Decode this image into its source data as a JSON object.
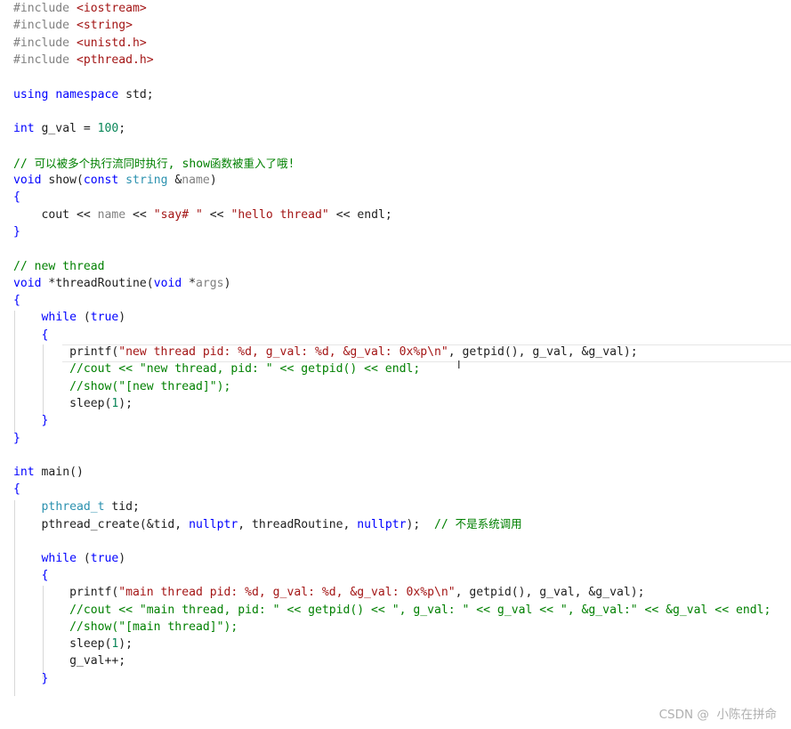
{
  "editor": {
    "lines": [
      [
        {
          "t": "#include ",
          "k": "pp"
        },
        {
          "t": "<iostream>",
          "k": "inc"
        }
      ],
      [
        {
          "t": "#include ",
          "k": "pp"
        },
        {
          "t": "<string>",
          "k": "inc"
        }
      ],
      [
        {
          "t": "#include ",
          "k": "pp"
        },
        {
          "t": "<unistd.h>",
          "k": "inc"
        }
      ],
      [
        {
          "t": "#include ",
          "k": "pp"
        },
        {
          "t": "<pthread.h>",
          "k": "inc"
        }
      ],
      [],
      [
        {
          "t": "using",
          "k": "kw"
        },
        {
          "t": " ",
          "k": "pl"
        },
        {
          "t": "namespace",
          "k": "kw"
        },
        {
          "t": " std;",
          "k": "pl"
        }
      ],
      [],
      [
        {
          "t": "int",
          "k": "kw"
        },
        {
          "t": " g_val = ",
          "k": "pl"
        },
        {
          "t": "100",
          "k": "num"
        },
        {
          "t": ";",
          "k": "pl"
        }
      ],
      [],
      [
        {
          "t": "// 可以被多个执行流同时执行, show函数被重入了哦!",
          "k": "cm"
        }
      ],
      [
        {
          "t": "void",
          "k": "kw"
        },
        {
          "t": " show",
          "k": "fn"
        },
        {
          "t": "(",
          "k": "pl"
        },
        {
          "t": "const",
          "k": "kw"
        },
        {
          "t": " ",
          "k": "pl"
        },
        {
          "t": "string",
          "k": "typ"
        },
        {
          "t": " &",
          "k": "pl"
        },
        {
          "t": "name",
          "k": "par"
        },
        {
          "t": ")",
          "k": "pl"
        }
      ],
      [
        {
          "t": "{",
          "k": "br"
        }
      ],
      [
        {
          "t": "    cout << ",
          "k": "pl"
        },
        {
          "t": "name",
          "k": "par"
        },
        {
          "t": " << ",
          "k": "pl"
        },
        {
          "t": "\"say# \"",
          "k": "str"
        },
        {
          "t": " << ",
          "k": "pl"
        },
        {
          "t": "\"hello thread\"",
          "k": "str"
        },
        {
          "t": " << endl;",
          "k": "pl"
        }
      ],
      [
        {
          "t": "}",
          "k": "br"
        }
      ],
      [],
      [
        {
          "t": "// new thread",
          "k": "cm"
        }
      ],
      [
        {
          "t": "void",
          "k": "kw"
        },
        {
          "t": " *threadRoutine(",
          "k": "pl"
        },
        {
          "t": "void",
          "k": "kw"
        },
        {
          "t": " *",
          "k": "pl"
        },
        {
          "t": "args",
          "k": "par"
        },
        {
          "t": ")",
          "k": "pl"
        }
      ],
      [
        {
          "t": "{",
          "k": "br"
        }
      ],
      [
        {
          "t": "    ",
          "k": "pl"
        },
        {
          "t": "while",
          "k": "kw"
        },
        {
          "t": " (",
          "k": "pl"
        },
        {
          "t": "true",
          "k": "kw"
        },
        {
          "t": ")",
          "k": "pl"
        }
      ],
      [
        {
          "t": "    ",
          "k": "pl"
        },
        {
          "t": "{",
          "k": "br"
        }
      ],
      [
        {
          "t": "        printf(",
          "k": "pl"
        },
        {
          "t": "\"new thread pid: %d, g_val: %d, &g_val: 0x%p\\n\"",
          "k": "str"
        },
        {
          "t": ", getpid(), g_val, &g_val);",
          "k": "pl"
        }
      ],
      [
        {
          "t": "        //cout << \"new thread, pid: \" << getpid() << endl;",
          "k": "cm"
        }
      ],
      [
        {
          "t": "        //show(\"[new thread]\");",
          "k": "cm"
        }
      ],
      [
        {
          "t": "        sleep(",
          "k": "pl"
        },
        {
          "t": "1",
          "k": "num"
        },
        {
          "t": ");",
          "k": "pl"
        }
      ],
      [
        {
          "t": "    ",
          "k": "pl"
        },
        {
          "t": "}",
          "k": "br"
        }
      ],
      [
        {
          "t": "}",
          "k": "br"
        }
      ],
      [],
      [
        {
          "t": "int",
          "k": "kw"
        },
        {
          "t": " main()",
          "k": "pl"
        }
      ],
      [
        {
          "t": "{",
          "k": "br"
        }
      ],
      [
        {
          "t": "    ",
          "k": "pl"
        },
        {
          "t": "pthread_t",
          "k": "typ"
        },
        {
          "t": " tid;",
          "k": "pl"
        }
      ],
      [
        {
          "t": "    pthread_create(&tid, ",
          "k": "pl"
        },
        {
          "t": "nullptr",
          "k": "kw"
        },
        {
          "t": ", threadRoutine, ",
          "k": "pl"
        },
        {
          "t": "nullptr",
          "k": "kw"
        },
        {
          "t": ");  ",
          "k": "pl"
        },
        {
          "t": "// 不是系统调用",
          "k": "cm"
        }
      ],
      [],
      [
        {
          "t": "    ",
          "k": "pl"
        },
        {
          "t": "while",
          "k": "kw"
        },
        {
          "t": " (",
          "k": "pl"
        },
        {
          "t": "true",
          "k": "kw"
        },
        {
          "t": ")",
          "k": "pl"
        }
      ],
      [
        {
          "t": "    ",
          "k": "pl"
        },
        {
          "t": "{",
          "k": "br"
        }
      ],
      [
        {
          "t": "        printf(",
          "k": "pl"
        },
        {
          "t": "\"main thread pid: %d, g_val: %d, &g_val: 0x%p\\n\"",
          "k": "str"
        },
        {
          "t": ", getpid(), g_val, &g_val);",
          "k": "pl"
        }
      ],
      [
        {
          "t": "        //cout << \"main thread, pid: \" << getpid() << \", g_val: \" << g_val << \", &g_val:\" << &g_val << endl;",
          "k": "cm"
        }
      ],
      [
        {
          "t": "        //show(\"[main thread]\");",
          "k": "cm"
        }
      ],
      [
        {
          "t": "        sleep(",
          "k": "pl"
        },
        {
          "t": "1",
          "k": "num"
        },
        {
          "t": ");",
          "k": "pl"
        }
      ],
      [
        {
          "t": "        g_val++;",
          "k": "pl"
        }
      ],
      [
        {
          "t": "    ",
          "k": "pl"
        },
        {
          "t": "}",
          "k": "br"
        }
      ]
    ]
  },
  "cursor_glyph": "I",
  "watermark": "CSDN @  小陈在拼命",
  "colors": {
    "keyword": "#0000ff",
    "type": "#2b91af",
    "string": "#a31515",
    "number": "#098658",
    "comment": "#008000",
    "preprocessor": "#808080",
    "parameter": "#808080",
    "text": "#1e1e1e"
  }
}
